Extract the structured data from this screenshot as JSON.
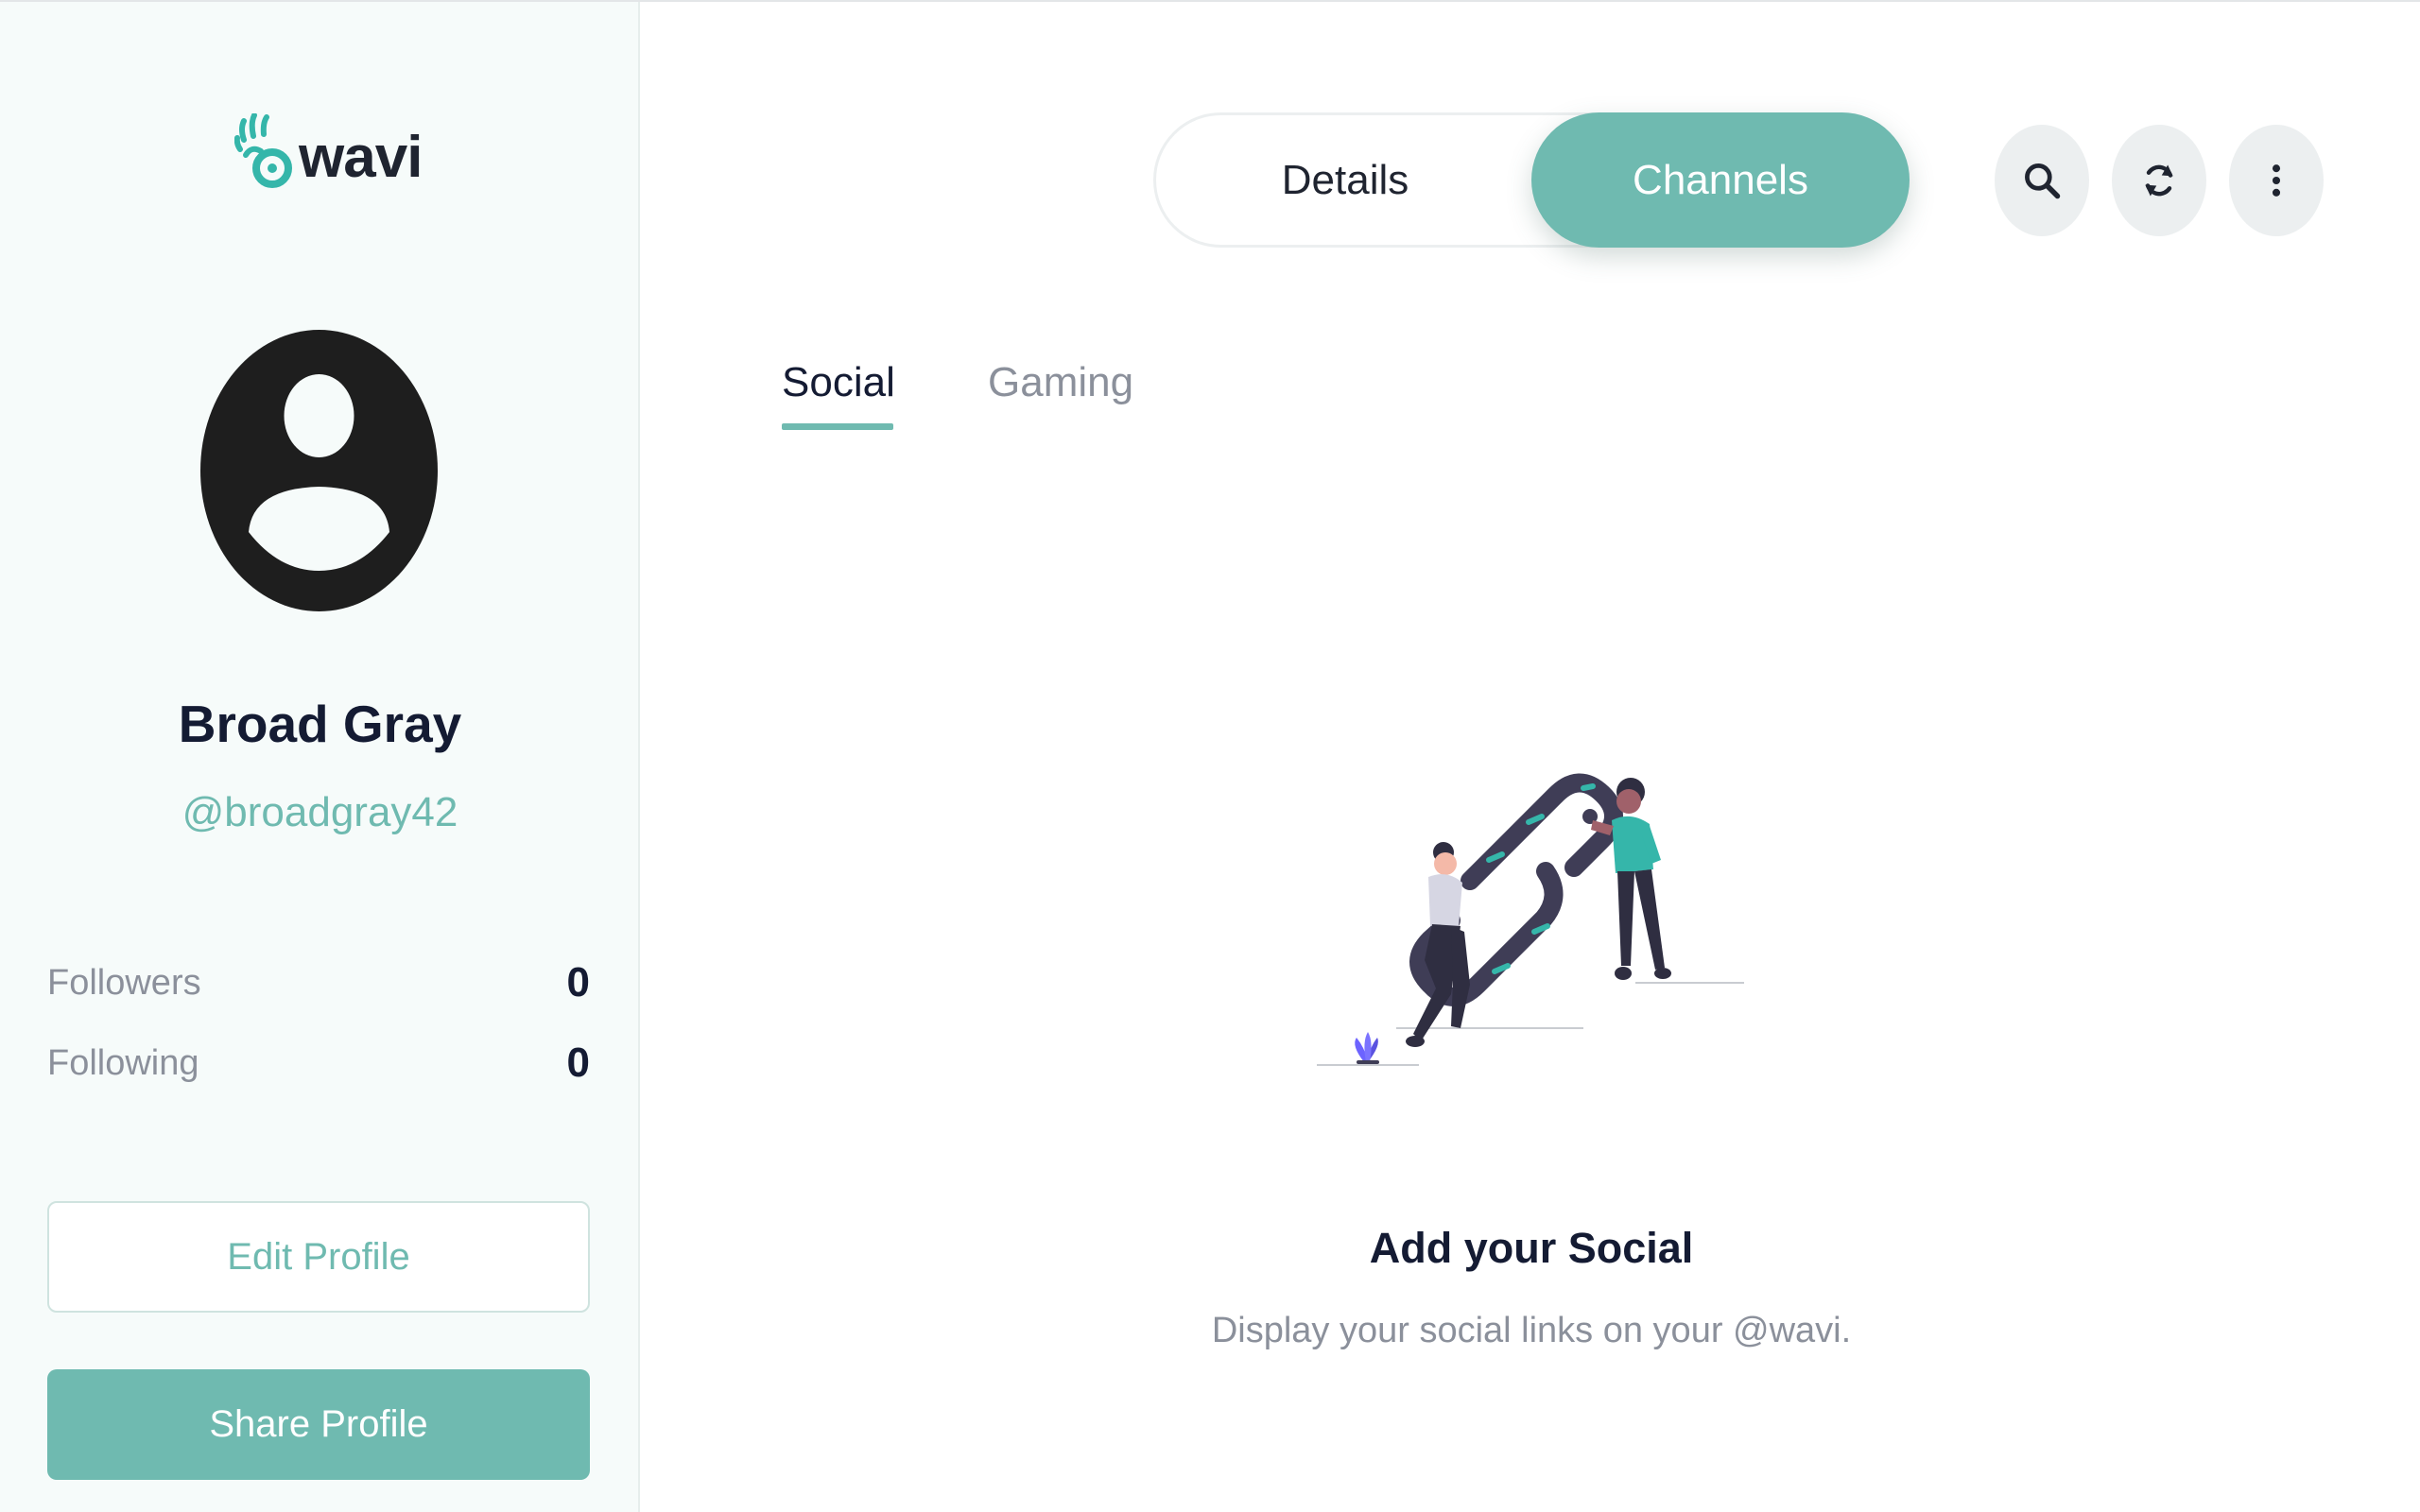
{
  "brand": {
    "name": "wavi",
    "icon": "hand-logo-icon"
  },
  "profile": {
    "name": "Broad Gray",
    "handle": "@broadgray42",
    "avatar_icon": "user-avatar-icon"
  },
  "stats": [
    {
      "label": "Followers",
      "value": "0"
    },
    {
      "label": "Following",
      "value": "0"
    }
  ],
  "actions": {
    "edit_label": "Edit Profile",
    "share_label": "Share Profile"
  },
  "segmented": {
    "options": [
      "Details",
      "Channels"
    ],
    "selected": "Channels"
  },
  "toolbar_icons": [
    "search-icon",
    "refresh-icon",
    "more-vertical-icon"
  ],
  "tabs": {
    "items": [
      "Social",
      "Gaming"
    ],
    "selected": "Social"
  },
  "empty_state": {
    "illustration": "link-illustration",
    "title": "Add your Social",
    "description": "Display your social links on your @wavi."
  },
  "colors": {
    "accent": "#6fbab0",
    "sidebar_bg": "#f6fbfa",
    "text_dark": "#141b33",
    "text_muted": "#8b909b"
  }
}
